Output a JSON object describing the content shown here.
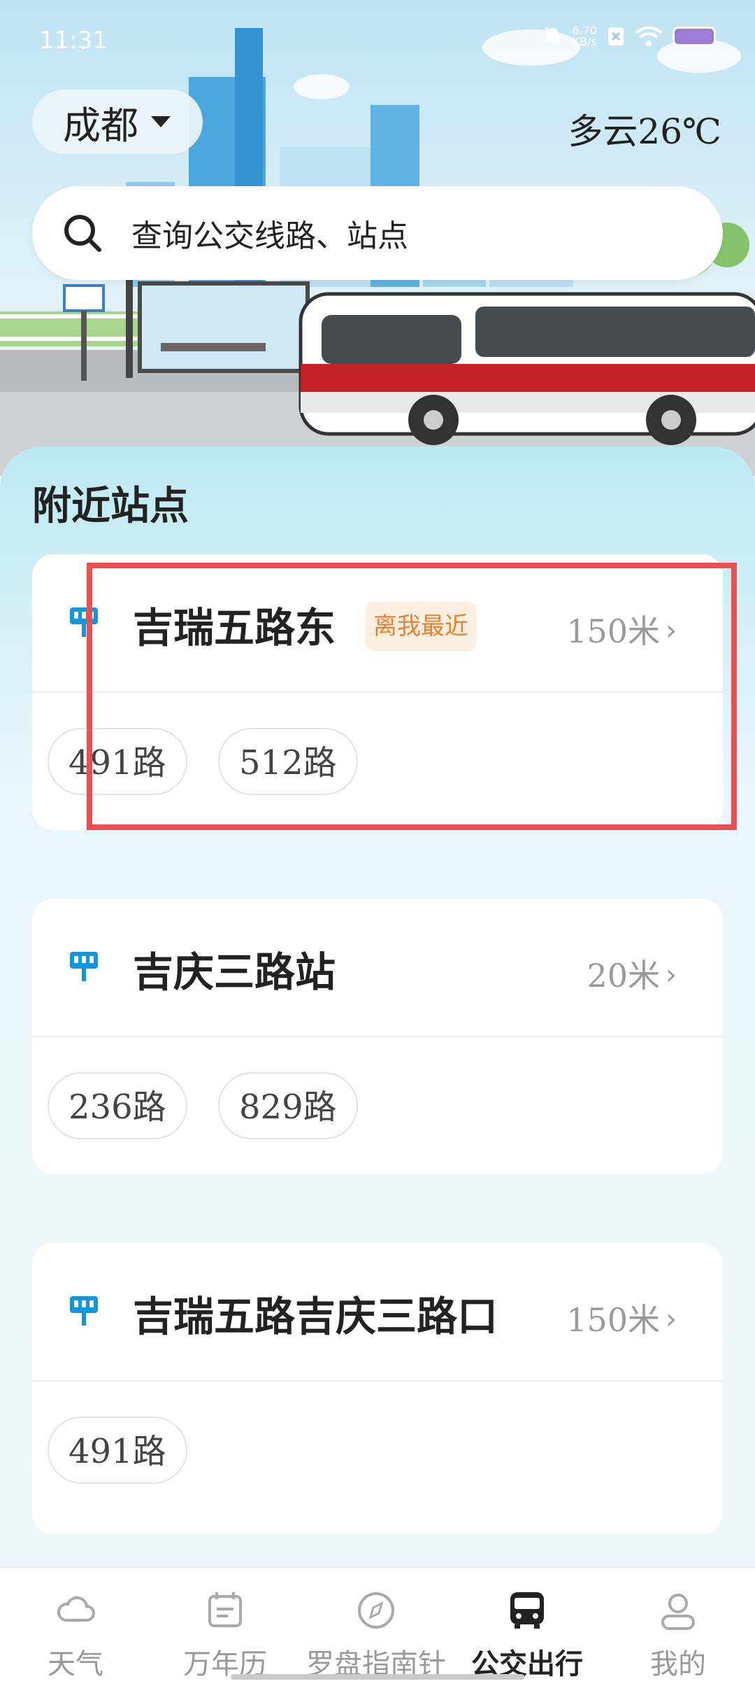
{
  "status": {
    "time": "11:31",
    "speed_value": "6.70",
    "speed_unit": "KB/s"
  },
  "header": {
    "city": "成都",
    "weather": "多云26℃"
  },
  "search": {
    "placeholder": "查询公交线路、站点"
  },
  "section": {
    "title": "附近站点"
  },
  "stations": [
    {
      "name": "吉瑞五路东",
      "badge": "离我最近",
      "distance": "150米",
      "routes": [
        "491路",
        "512路"
      ]
    },
    {
      "name": "吉庆三路站",
      "distance": "20米",
      "routes": [
        "236路",
        "829路"
      ]
    },
    {
      "name": "吉瑞五路吉庆三路口",
      "distance": "150米",
      "routes": [
        "491路"
      ]
    }
  ],
  "tabs": [
    {
      "label": "天气",
      "icon": "cloud-icon"
    },
    {
      "label": "万年历",
      "icon": "calendar-icon"
    },
    {
      "label": "罗盘指南针",
      "icon": "compass-icon"
    },
    {
      "label": "公交出行",
      "icon": "bus-icon",
      "active": true
    },
    {
      "label": "我的",
      "icon": "user-icon"
    }
  ],
  "colors": {
    "accent": "#1296db",
    "badge_text": "#e9822e",
    "badge_bg": "#fdeee2",
    "highlight": "#e9504f"
  }
}
